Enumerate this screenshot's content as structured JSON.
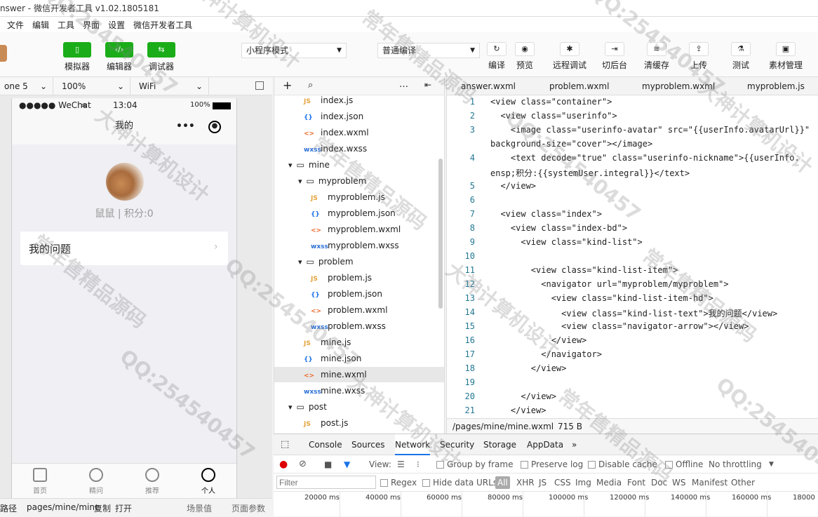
{
  "titlebar": {
    "title": "nswer - 微信开发者工具 v1.02.1805181"
  },
  "menubar": [
    "文件",
    "编辑",
    "工具",
    "界面",
    "设置",
    "微信开发者工具"
  ],
  "toolbar": {
    "modes": [
      {
        "icon": "phone-icon",
        "label": "模拟器"
      },
      {
        "icon": "code-icon",
        "label": "编辑器"
      },
      {
        "icon": "debug-icon",
        "label": "调试器"
      }
    ],
    "mode_select": "小程序模式",
    "compile_select": "普通编译",
    "actions": [
      {
        "icon": "refresh-icon",
        "label": "编译"
      },
      {
        "icon": "eye-icon",
        "label": "预览"
      },
      {
        "icon": "bug-icon",
        "label": "远程调试"
      },
      {
        "icon": "switch-icon",
        "label": "切后台"
      },
      {
        "icon": "layers-icon",
        "label": "清缓存"
      },
      {
        "icon": "upload-icon",
        "label": "上传"
      },
      {
        "icon": "flask-icon",
        "label": "测试"
      },
      {
        "icon": "image-icon",
        "label": "素材管理"
      }
    ]
  },
  "simulator": {
    "device": "one 5",
    "zoom": "100%",
    "network": "WiFi",
    "status": {
      "carrier": "●●●●● WeChat",
      "time": "13:04",
      "battery": "100%"
    },
    "nav_title": "我的",
    "nav_more": "•••",
    "user_line": "鼠鼠 | 积分:0",
    "question_row": "我的问题",
    "tabs": [
      {
        "label": "首页",
        "icon": "home-icon"
      },
      {
        "label": "精问",
        "icon": "circle-icon"
      },
      {
        "label": "推荐",
        "icon": "target-icon"
      },
      {
        "label": "个人",
        "icon": "user-icon"
      }
    ],
    "footer": {
      "path_label": "路径",
      "path": "pages/mine/mine",
      "copy": "复制",
      "open": "打开",
      "scene": "场景值",
      "params": "页面参数"
    }
  },
  "filetree": {
    "items": [
      {
        "type": "JS",
        "name": "index.js",
        "indent": 0
      },
      {
        "type": "{}",
        "name": "index.json",
        "indent": 0
      },
      {
        "type": "<>",
        "name": "index.wxml",
        "indent": 0
      },
      {
        "type": "wxss",
        "name": "index.wxss",
        "indent": 0
      },
      {
        "type": "folder",
        "name": "mine",
        "indent": -1
      },
      {
        "type": "folder",
        "name": "myproblem",
        "indent": 0
      },
      {
        "type": "JS",
        "name": "myproblem.js",
        "indent": 1
      },
      {
        "type": "{}",
        "name": "myproblem.json",
        "indent": 1
      },
      {
        "type": "<>",
        "name": "myproblem.wxml",
        "indent": 1
      },
      {
        "type": "wxss",
        "name": "myproblem.wxss",
        "indent": 1
      },
      {
        "type": "folder",
        "name": "problem",
        "indent": 0
      },
      {
        "type": "JS",
        "name": "problem.js",
        "indent": 1
      },
      {
        "type": "{}",
        "name": "problem.json",
        "indent": 1
      },
      {
        "type": "<>",
        "name": "problem.wxml",
        "indent": 1
      },
      {
        "type": "wxss",
        "name": "problem.wxss",
        "indent": 1
      },
      {
        "type": "JS",
        "name": "mine.js",
        "indent": 0
      },
      {
        "type": "{}",
        "name": "mine.json",
        "indent": 0
      },
      {
        "type": "<>",
        "name": "mine.wxml",
        "indent": 0
      },
      {
        "type": "wxss",
        "name": "mine.wxss",
        "indent": 0
      },
      {
        "type": "folder",
        "name": "post",
        "indent": -1
      },
      {
        "type": "JS",
        "name": "post.js",
        "indent": 0
      }
    ]
  },
  "editor": {
    "tabs": [
      "answer.wxml",
      "problem.wxml",
      "myproblem.wxml",
      "myproblem.js"
    ],
    "lines": [
      "<view class=\"container\">",
      "  <view class=\"userinfo\">",
      "    <image class=\"userinfo-avatar\" src=\"{{userInfo.avatarUrl}}\"",
      "background-size=\"cover\"></image>",
      "    <text decode=\"true\" class=\"userinfo-nickname\">{{userInfo.",
      "ensp;积分:{{systemUser.integral}}</text>",
      "  </view>",
      "",
      "  <view class=\"index\">",
      "    <view class=\"index-bd\">",
      "      <view class=\"kind-list\">",
      "",
      "        <view class=\"kind-list-item\">",
      "          <navigator url=\"myproblem/myproblem\">",
      "            <view class=\"kind-list-item-hd\">",
      "              <view class=\"kind-list-text\">我的问题</view>",
      "              <view class=\"navigator-arrow\"></view>",
      "            </view>",
      "          </navigator>",
      "        </view>",
      "",
      "      </view>",
      "    </view>"
    ],
    "line_numbers": [
      "1",
      "2",
      "3",
      "",
      "4",
      "",
      "5",
      "6",
      "7",
      "8",
      "9",
      "10",
      "11",
      "12",
      "13",
      "14",
      "15",
      "16",
      "17",
      "18",
      "19",
      "20",
      "21"
    ],
    "footer_path": "/pages/mine/mine.wxml",
    "footer_size": "715 B"
  },
  "devtools": {
    "tabs": [
      "Console",
      "Sources",
      "Network",
      "Security",
      "Storage",
      "AppData",
      "»"
    ],
    "active_tab": "Network",
    "row2": {
      "view": "View:",
      "group": "Group by frame",
      "preserve": "Preserve log",
      "disable": "Disable cache",
      "offline": "Offline",
      "throttle": "No throttling"
    },
    "filter_placeholder": "Filter",
    "regex": "Regex",
    "hide": "Hide data URLs",
    "types": [
      "All",
      "XHR",
      "JS",
      "CSS",
      "Img",
      "Media",
      "Font",
      "Doc",
      "WS",
      "Manifest",
      "Other"
    ],
    "ticks": [
      "20000 ms",
      "40000 ms",
      "60000 ms",
      "80000 ms",
      "100000 ms",
      "120000 ms",
      "140000 ms",
      "160000 ms",
      "18000"
    ]
  },
  "watermarks": [
    "QQ:254540457",
    "大神计算机设计",
    "常年售精品源码"
  ]
}
